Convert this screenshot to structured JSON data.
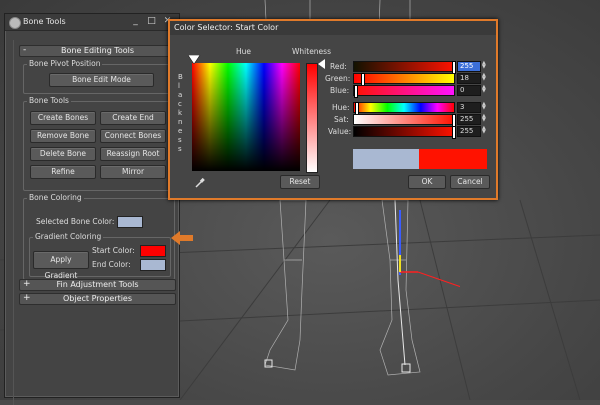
{
  "bone_tools": {
    "title": "Bone Tools",
    "window_buttons": {
      "minimize": "_",
      "maximize": "□",
      "close": "✕"
    },
    "rollout_bone_editing": {
      "sign": "-",
      "title": "Bone Editing Tools"
    },
    "pivot_group": {
      "label": "Bone Pivot Position",
      "edit_mode": "Bone Edit Mode"
    },
    "tools_group": {
      "label": "Bone Tools",
      "create_bones": "Create Bones",
      "create_end": "Create End",
      "remove_bone": "Remove Bone",
      "connect_bones": "Connect Bones",
      "delete_bone": "Delete Bone",
      "reassign_root": "Reassign Root",
      "refine": "Refine",
      "mirror": "Mirror"
    },
    "coloring_group": {
      "label": "Bone Coloring",
      "selected_label": "Selected Bone Color:",
      "selected_color": "#a9b8d2",
      "gradient_label": "Gradient Coloring",
      "apply_gradient": "Apply Gradient",
      "start_label": "Start Color:",
      "start_color": "#ff0000",
      "end_label": "End Color:",
      "end_color": "#a9b8d2"
    },
    "rollout_fin": {
      "sign": "+",
      "title": "Fin Adjustment Tools"
    },
    "rollout_props": {
      "sign": "+",
      "title": "Object Properties"
    }
  },
  "color_selector": {
    "title": "Color Selector: Start Color",
    "hue_label": "Hue",
    "whiteness_label": "Whiteness",
    "blackness_label": "B\nl\na\nc\nk\nn\ne\ns\ns",
    "reset": "Reset",
    "ok": "OK",
    "cancel": "Cancel",
    "channels": {
      "red": {
        "label": "Red:",
        "value": "255"
      },
      "green": {
        "label": "Green:",
        "value": "18"
      },
      "blue": {
        "label": "Blue:",
        "value": "0"
      },
      "hue": {
        "label": "Hue:",
        "value": "3"
      },
      "sat": {
        "label": "Sat:",
        "value": "255"
      },
      "value": {
        "label": "Value:",
        "value": "255"
      }
    },
    "old_color": "#a9b8d2",
    "new_color": "#ff1200"
  },
  "accent": "#e07a2a"
}
